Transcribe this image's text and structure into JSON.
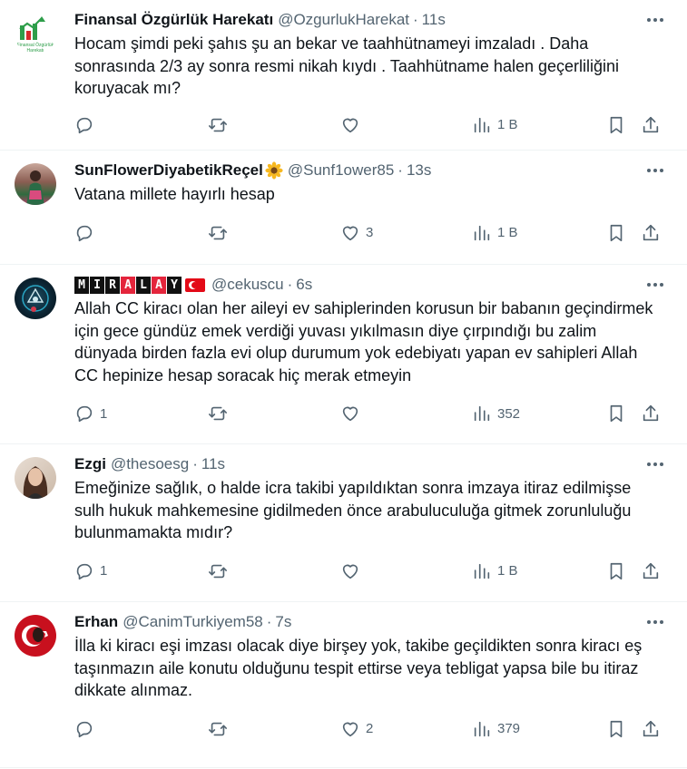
{
  "tweets": [
    {
      "name": "Finansal Özgürlük Harekatı",
      "handle": "@OzgurlukHarekat",
      "dot": "·",
      "time": "11s",
      "avatar_text": "Finansal Özgürlük Harekatı",
      "text": "Hocam şimdi peki şahıs şu an bekar ve  taahhütnameyi imzaladı . Daha sonrasında 2/3 ay sonra resmi nikah kıydı . Taahhütname halen geçerliliğini koruyacak mı?",
      "replies": "",
      "retweets": "",
      "likes": "",
      "views": "1 B"
    },
    {
      "name": "SunFlowerDiyabetikReçel",
      "handle": "@Sunf1ower85",
      "dot": "·",
      "time": "13s",
      "text": "Vatana millete hayırlı hesap",
      "replies": "",
      "retweets": "",
      "likes": "3",
      "views": "1 B"
    },
    {
      "name_boxes": [
        "M",
        "I",
        "R",
        "A",
        "L",
        "A",
        "Y"
      ],
      "handle": "@cekuscu",
      "dot": "·",
      "time": "6s",
      "text": "Allah CC kiracı olan her aileyi ev sahiplerinden korusun bir babanın geçindirmek için gece gündüz emek verdiği yuvası yıkılmasın diye çırpındığı bu zalim dünyada birden fazla evi olup durumum yok edebiyatı yapan ev sahipleri Allah CC hepinize hesap soracak hiç merak etmeyin",
      "replies": "1",
      "retweets": "",
      "likes": "",
      "views": "352"
    },
    {
      "name": "Ezgi",
      "handle": "@thesoesg",
      "dot": "·",
      "time": "11s",
      "text": "Emeğinize sağlık, o halde icra takibi yapıldıktan sonra imzaya itiraz edilmişse sulh hukuk mahkemesine gidilmeden önce arabuluculuğa gitmek zorunluluğu bulunmamakta mıdır?",
      "replies": "1",
      "retweets": "",
      "likes": "",
      "views": "1 B"
    },
    {
      "name": "Erhan",
      "handle": "@CanimTurkiyem58",
      "dot": "·",
      "time": "7s",
      "text": "İlla ki kiracı eşi imzası olacak diye birşey yok, takibe geçildikten sonra kiracı eş taşınmazın aile konutu olduğunu tespit ettirse veya tebligat yapsa bile bu itiraz dikkate alınmaz.",
      "replies": "",
      "retweets": "",
      "likes": "2",
      "views": "379"
    }
  ],
  "icons": {
    "reply": "reply-icon",
    "retweet": "retweet-icon",
    "like": "heart-icon",
    "views": "views-icon",
    "bookmark": "bookmark-icon",
    "share": "share-icon",
    "more": "more-icon"
  },
  "colors": {
    "secondary_text": "#536471",
    "border": "#eff3f4",
    "flag_red": "#e30a17",
    "miralay_red": "#e4253c"
  }
}
